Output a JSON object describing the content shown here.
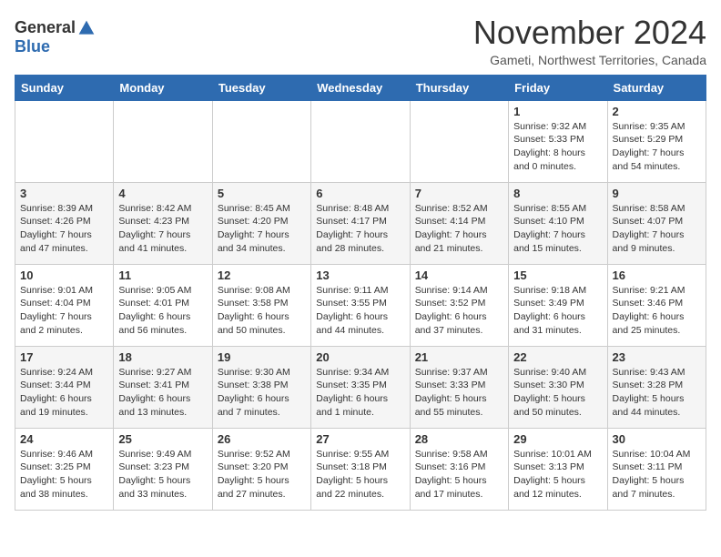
{
  "logo": {
    "general": "General",
    "blue": "Blue"
  },
  "title": "November 2024",
  "location": "Gameti, Northwest Territories, Canada",
  "weekdays": [
    "Sunday",
    "Monday",
    "Tuesday",
    "Wednesday",
    "Thursday",
    "Friday",
    "Saturday"
  ],
  "weeks": [
    [
      {
        "day": "",
        "info": ""
      },
      {
        "day": "",
        "info": ""
      },
      {
        "day": "",
        "info": ""
      },
      {
        "day": "",
        "info": ""
      },
      {
        "day": "",
        "info": ""
      },
      {
        "day": "1",
        "info": "Sunrise: 9:32 AM\nSunset: 5:33 PM\nDaylight: 8 hours\nand 0 minutes."
      },
      {
        "day": "2",
        "info": "Sunrise: 9:35 AM\nSunset: 5:29 PM\nDaylight: 7 hours\nand 54 minutes."
      }
    ],
    [
      {
        "day": "3",
        "info": "Sunrise: 8:39 AM\nSunset: 4:26 PM\nDaylight: 7 hours\nand 47 minutes."
      },
      {
        "day": "4",
        "info": "Sunrise: 8:42 AM\nSunset: 4:23 PM\nDaylight: 7 hours\nand 41 minutes."
      },
      {
        "day": "5",
        "info": "Sunrise: 8:45 AM\nSunset: 4:20 PM\nDaylight: 7 hours\nand 34 minutes."
      },
      {
        "day": "6",
        "info": "Sunrise: 8:48 AM\nSunset: 4:17 PM\nDaylight: 7 hours\nand 28 minutes."
      },
      {
        "day": "7",
        "info": "Sunrise: 8:52 AM\nSunset: 4:14 PM\nDaylight: 7 hours\nand 21 minutes."
      },
      {
        "day": "8",
        "info": "Sunrise: 8:55 AM\nSunset: 4:10 PM\nDaylight: 7 hours\nand 15 minutes."
      },
      {
        "day": "9",
        "info": "Sunrise: 8:58 AM\nSunset: 4:07 PM\nDaylight: 7 hours\nand 9 minutes."
      }
    ],
    [
      {
        "day": "10",
        "info": "Sunrise: 9:01 AM\nSunset: 4:04 PM\nDaylight: 7 hours\nand 2 minutes."
      },
      {
        "day": "11",
        "info": "Sunrise: 9:05 AM\nSunset: 4:01 PM\nDaylight: 6 hours\nand 56 minutes."
      },
      {
        "day": "12",
        "info": "Sunrise: 9:08 AM\nSunset: 3:58 PM\nDaylight: 6 hours\nand 50 minutes."
      },
      {
        "day": "13",
        "info": "Sunrise: 9:11 AM\nSunset: 3:55 PM\nDaylight: 6 hours\nand 44 minutes."
      },
      {
        "day": "14",
        "info": "Sunrise: 9:14 AM\nSunset: 3:52 PM\nDaylight: 6 hours\nand 37 minutes."
      },
      {
        "day": "15",
        "info": "Sunrise: 9:18 AM\nSunset: 3:49 PM\nDaylight: 6 hours\nand 31 minutes."
      },
      {
        "day": "16",
        "info": "Sunrise: 9:21 AM\nSunset: 3:46 PM\nDaylight: 6 hours\nand 25 minutes."
      }
    ],
    [
      {
        "day": "17",
        "info": "Sunrise: 9:24 AM\nSunset: 3:44 PM\nDaylight: 6 hours\nand 19 minutes."
      },
      {
        "day": "18",
        "info": "Sunrise: 9:27 AM\nSunset: 3:41 PM\nDaylight: 6 hours\nand 13 minutes."
      },
      {
        "day": "19",
        "info": "Sunrise: 9:30 AM\nSunset: 3:38 PM\nDaylight: 6 hours\nand 7 minutes."
      },
      {
        "day": "20",
        "info": "Sunrise: 9:34 AM\nSunset: 3:35 PM\nDaylight: 6 hours\nand 1 minute."
      },
      {
        "day": "21",
        "info": "Sunrise: 9:37 AM\nSunset: 3:33 PM\nDaylight: 5 hours\nand 55 minutes."
      },
      {
        "day": "22",
        "info": "Sunrise: 9:40 AM\nSunset: 3:30 PM\nDaylight: 5 hours\nand 50 minutes."
      },
      {
        "day": "23",
        "info": "Sunrise: 9:43 AM\nSunset: 3:28 PM\nDaylight: 5 hours\nand 44 minutes."
      }
    ],
    [
      {
        "day": "24",
        "info": "Sunrise: 9:46 AM\nSunset: 3:25 PM\nDaylight: 5 hours\nand 38 minutes."
      },
      {
        "day": "25",
        "info": "Sunrise: 9:49 AM\nSunset: 3:23 PM\nDaylight: 5 hours\nand 33 minutes."
      },
      {
        "day": "26",
        "info": "Sunrise: 9:52 AM\nSunset: 3:20 PM\nDaylight: 5 hours\nand 27 minutes."
      },
      {
        "day": "27",
        "info": "Sunrise: 9:55 AM\nSunset: 3:18 PM\nDaylight: 5 hours\nand 22 minutes."
      },
      {
        "day": "28",
        "info": "Sunrise: 9:58 AM\nSunset: 3:16 PM\nDaylight: 5 hours\nand 17 minutes."
      },
      {
        "day": "29",
        "info": "Sunrise: 10:01 AM\nSunset: 3:13 PM\nDaylight: 5 hours\nand 12 minutes."
      },
      {
        "day": "30",
        "info": "Sunrise: 10:04 AM\nSunset: 3:11 PM\nDaylight: 5 hours\nand 7 minutes."
      }
    ]
  ]
}
